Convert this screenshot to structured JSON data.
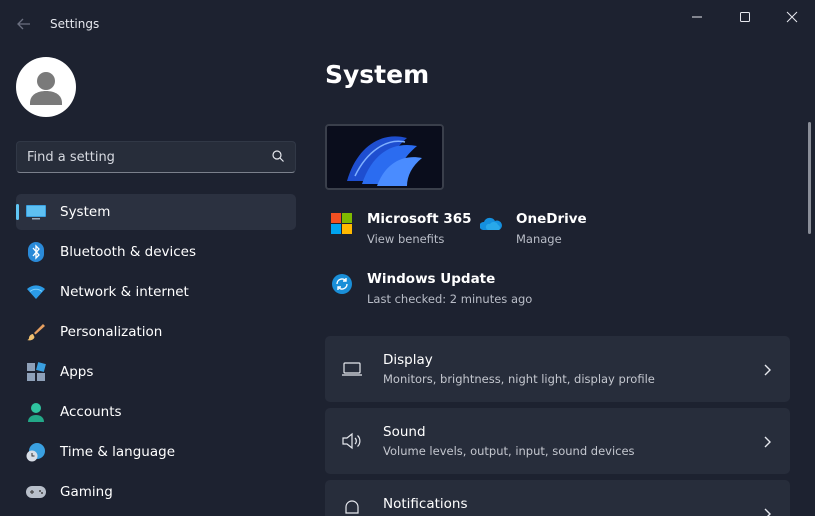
{
  "window": {
    "app_title": "Settings",
    "controls": [
      "minimize",
      "maximize",
      "close"
    ]
  },
  "search": {
    "placeholder": "Find a setting"
  },
  "sidebar": {
    "items": [
      {
        "label": "System",
        "icon": "monitor-icon",
        "active": true
      },
      {
        "label": "Bluetooth & devices",
        "icon": "bluetooth-icon"
      },
      {
        "label": "Network & internet",
        "icon": "wifi-icon"
      },
      {
        "label": "Personalization",
        "icon": "paintbrush-icon"
      },
      {
        "label": "Apps",
        "icon": "apps-icon"
      },
      {
        "label": "Accounts",
        "icon": "person-icon"
      },
      {
        "label": "Time & language",
        "icon": "globe-clock-icon"
      },
      {
        "label": "Gaming",
        "icon": "gamepad-icon"
      }
    ]
  },
  "main": {
    "title": "System",
    "quick_links": [
      {
        "title": "Microsoft 365",
        "subtitle": "View benefits",
        "icon": "microsoft-logo-icon"
      },
      {
        "title": "OneDrive",
        "subtitle": "Manage",
        "icon": "onedrive-cloud-icon"
      },
      {
        "title": "Windows Update",
        "subtitle": "Last checked: 2 minutes ago",
        "icon": "windows-update-icon"
      }
    ],
    "cards": [
      {
        "title": "Display",
        "subtitle": "Monitors, brightness, night light, display profile",
        "icon": "laptop-icon"
      },
      {
        "title": "Sound",
        "subtitle": "Volume levels, output, input, sound devices",
        "icon": "speaker-icon"
      },
      {
        "title": "Notifications",
        "subtitle": "",
        "icon": "bell-icon"
      }
    ]
  },
  "colors": {
    "background": "#1d2230",
    "card": "#272d3b",
    "accent": "#60c6f5",
    "selected_nav": "#2b3140"
  }
}
